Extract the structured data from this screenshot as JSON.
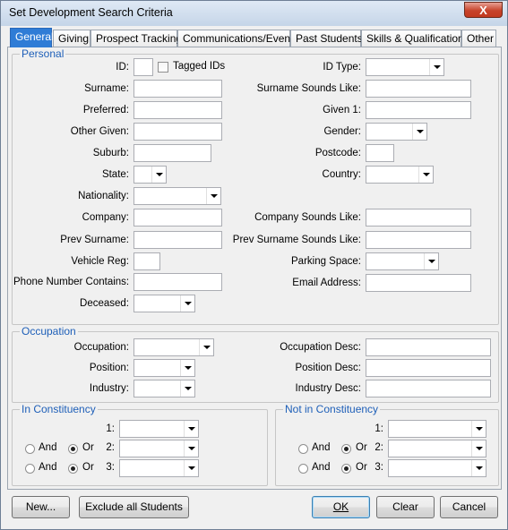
{
  "window": {
    "title": "Set Development Search Criteria",
    "close_glyph": "X"
  },
  "tabs": [
    {
      "label": "General"
    },
    {
      "label": "Giving"
    },
    {
      "label": "Prospect Tracking"
    },
    {
      "label": "Communications/Events"
    },
    {
      "label": "Past Students"
    },
    {
      "label": "Skills & Qualifications"
    },
    {
      "label": "Other"
    }
  ],
  "personal": {
    "legend": "Personal",
    "id": "ID:",
    "tagged_ids": "Tagged IDs",
    "id_type": "ID Type:",
    "surname": "Surname:",
    "surname_sounds_like": "Surname Sounds Like:",
    "preferred": "Preferred:",
    "given1": "Given 1:",
    "other_given": "Other Given:",
    "gender": "Gender:",
    "suburb": "Suburb:",
    "postcode": "Postcode:",
    "state": "State:",
    "country": "Country:",
    "nationality": "Nationality:",
    "company": "Company:",
    "company_sounds_like": "Company Sounds Like:",
    "prev_surname": "Prev Surname:",
    "prev_surname_sounds_like": "Prev Surname Sounds Like:",
    "vehicle_reg": "Vehicle Reg:",
    "parking_space": "Parking Space:",
    "phone_number_contains": "Phone Number Contains:",
    "email_address": "Email Address:",
    "deceased": "Deceased:"
  },
  "occupation": {
    "legend": "Occupation",
    "occupation": "Occupation:",
    "occupation_desc": "Occupation Desc:",
    "position": "Position:",
    "position_desc": "Position Desc:",
    "industry": "Industry:",
    "industry_desc": "Industry Desc:"
  },
  "in_constituency": {
    "legend": "In Constituency",
    "row1": "1:",
    "row2": "2:",
    "row3": "3:",
    "and": "And",
    "or": "Or"
  },
  "not_in_constituency": {
    "legend": "Not in Constituency",
    "row1": "1:",
    "row2": "2:",
    "row3": "3:",
    "and": "And",
    "or": "Or"
  },
  "buttons": {
    "new": "New...",
    "exclude_all_students": "Exclude all Students",
    "ok": "OK",
    "clear": "Clear",
    "cancel": "Cancel"
  }
}
